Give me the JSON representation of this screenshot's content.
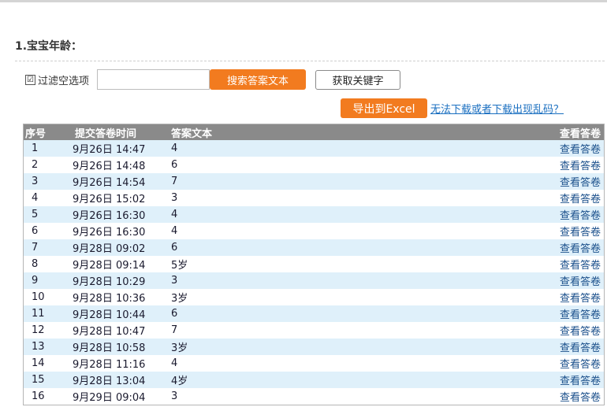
{
  "question": {
    "title": "1.宝宝年龄："
  },
  "filter": {
    "checkbox_checked": "☑",
    "checkbox_label": "过滤空选项",
    "input_value": "",
    "input_placeholder": ""
  },
  "buttons": {
    "search": "搜索答案文本",
    "keywords": "获取关键字",
    "export": "导出到Excel"
  },
  "help_link": "无法下载或者下载出现乱码？",
  "table": {
    "headers": [
      "序号",
      "提交答卷时间",
      "答案文本",
      "查看答卷"
    ],
    "rows": [
      {
        "no": "1",
        "time": "9月26日 14:47",
        "answer": "4",
        "action": "查看答卷"
      },
      {
        "no": "2",
        "time": "9月26日 14:48",
        "answer": "6",
        "action": "查看答卷"
      },
      {
        "no": "3",
        "time": "9月26日 14:54",
        "answer": "7",
        "action": "查看答卷"
      },
      {
        "no": "4",
        "time": "9月26日 15:02",
        "answer": "3",
        "action": "查看答卷"
      },
      {
        "no": "5",
        "time": "9月26日 16:30",
        "answer": "4",
        "action": "查看答卷"
      },
      {
        "no": "6",
        "time": "9月26日 16:30",
        "answer": "4",
        "action": "查看答卷"
      },
      {
        "no": "7",
        "time": "9月28日 09:02",
        "answer": "6",
        "action": "查看答卷"
      },
      {
        "no": "8",
        "time": "9月28日 09:14",
        "answer": "5岁",
        "action": "查看答卷"
      },
      {
        "no": "9",
        "time": "9月28日 10:29",
        "answer": "3",
        "action": "查看答卷"
      },
      {
        "no": "10",
        "time": "9月28日 10:36",
        "answer": "3岁",
        "action": "查看答卷"
      },
      {
        "no": "11",
        "time": "9月28日 10:44",
        "answer": "6",
        "action": "查看答卷"
      },
      {
        "no": "12",
        "time": "9月28日 10:47",
        "answer": "7",
        "action": "查看答卷"
      },
      {
        "no": "13",
        "time": "9月28日 10:58",
        "answer": "3岁",
        "action": "查看答卷"
      },
      {
        "no": "14",
        "time": "9月28日 11:16",
        "answer": "4",
        "action": "查看答卷"
      },
      {
        "no": "15",
        "time": "9月28日 13:04",
        "answer": "4岁",
        "action": "查看答卷"
      },
      {
        "no": "16",
        "time": "9月29日 09:04",
        "answer": "3",
        "action": "查看答卷"
      }
    ]
  },
  "colors": {
    "accent_orange": "#f27b1f",
    "header_gray": "#8a8a8a",
    "row_stripe": "#dff0fa",
    "link_blue": "#1a6fc0"
  }
}
